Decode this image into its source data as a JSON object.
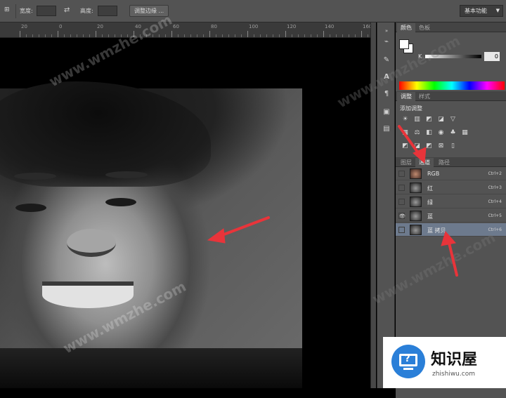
{
  "options_bar": {
    "width_label": "宽度:",
    "height_label": "高度:",
    "refine_edge_button": "调整边缘 ...",
    "workspace_label": "基本功能"
  },
  "ruler": {
    "ticks": [
      "20",
      "0",
      "20",
      "40",
      "60",
      "80",
      "100",
      "120",
      "140",
      "160",
      "180"
    ]
  },
  "color_panel": {
    "tabs": [
      "颜色",
      "色板"
    ],
    "k_label": "K",
    "k_value": "0"
  },
  "adjust_panel": {
    "tabs": [
      "调整",
      "样式"
    ],
    "title": "添加调整"
  },
  "channels_panel": {
    "tabs": [
      "图层",
      "通道",
      "路径"
    ],
    "rows": [
      {
        "name": "RGB",
        "key": "Ctrl+2",
        "visible": false
      },
      {
        "name": "红",
        "key": "Ctrl+3",
        "visible": false
      },
      {
        "name": "绿",
        "key": "Ctrl+4",
        "visible": false
      },
      {
        "name": "蓝",
        "key": "Ctrl+5",
        "visible": true
      },
      {
        "name": "蓝 拷贝",
        "key": "Ctrl+6",
        "visible": false
      }
    ]
  },
  "watermark": "www.wmzhe.com",
  "badge": {
    "name": "知识屋",
    "url": "zhishiwu.com"
  },
  "colors": {
    "selected_row": "#6d7a8d",
    "arrow": "#e8343a",
    "panel_bg": "#535353"
  }
}
